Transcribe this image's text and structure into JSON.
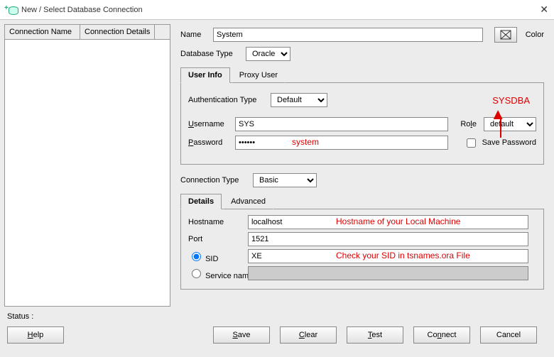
{
  "window": {
    "title": "New / Select Database Connection"
  },
  "left": {
    "col1": "Connection Name",
    "col2": "Connection Details"
  },
  "form": {
    "name_label": "Name",
    "name_value": "System",
    "color_label": "Color",
    "dbtype_label": "Database Type",
    "dbtype_value": "Oracle",
    "tab_userinfo": "User Info",
    "tab_proxyuser": "Proxy User",
    "authtype_label": "Authentication Type",
    "authtype_value": "Default",
    "username_label": "Username",
    "username_value": "SYS",
    "password_label": "Password",
    "password_value": "••••••",
    "role_label": "Role",
    "role_value": "default",
    "savepw_label": "Save Password",
    "conntype_label": "Connection Type",
    "conntype_value": "Basic",
    "tab_details": "Details",
    "tab_advanced": "Advanced",
    "hostname_label": "Hostname",
    "hostname_value": "localhost",
    "port_label": "Port",
    "port_value": "1521",
    "sid_label": "SID",
    "sid_value": "XE",
    "service_label": "Service name"
  },
  "annotations": {
    "sysdba": "SYSDBA",
    "password_hint": "system",
    "hostname_hint": "Hostname of your Local Machine",
    "sid_hint": "Check your SID in tsnames.ora File"
  },
  "status": {
    "label": "Status :"
  },
  "buttons": {
    "help": "Help",
    "save": "Save",
    "clear": "Clear",
    "test": "Test",
    "connect": "Connect",
    "cancel": "Cancel"
  }
}
